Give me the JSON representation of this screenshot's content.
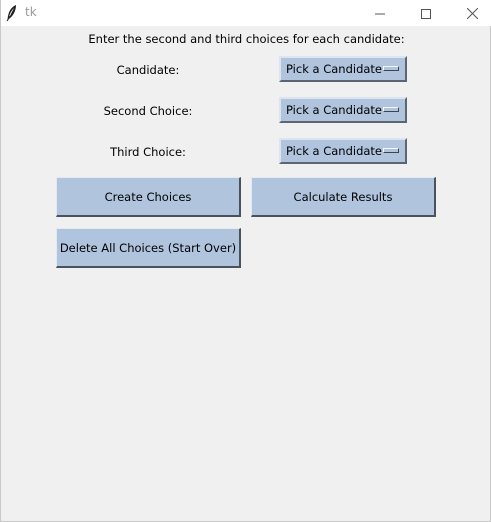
{
  "window": {
    "title": "tk"
  },
  "titlebar": {
    "app_icon": "feather-icon",
    "minimize_icon": "minimize-icon",
    "maximize_icon": "maximize-icon",
    "close_icon": "close-icon"
  },
  "main": {
    "instruction": "Enter the second and third choices for each candidate:",
    "rows": [
      {
        "label": "Candidate:",
        "selected": "Pick a Candidate"
      },
      {
        "label": "Second Choice:",
        "selected": "Pick a Candidate"
      },
      {
        "label": "Third Choice:",
        "selected": "Pick a Candidate"
      }
    ],
    "buttons": {
      "create": "Create Choices",
      "calculate": "Calculate Results",
      "delete": "Delete All Choices (Start Over)"
    }
  },
  "colors": {
    "window_bg": "#f0f0f0",
    "widget_bg": "#b0c4de",
    "titlebar_bg": "#ffffff"
  }
}
